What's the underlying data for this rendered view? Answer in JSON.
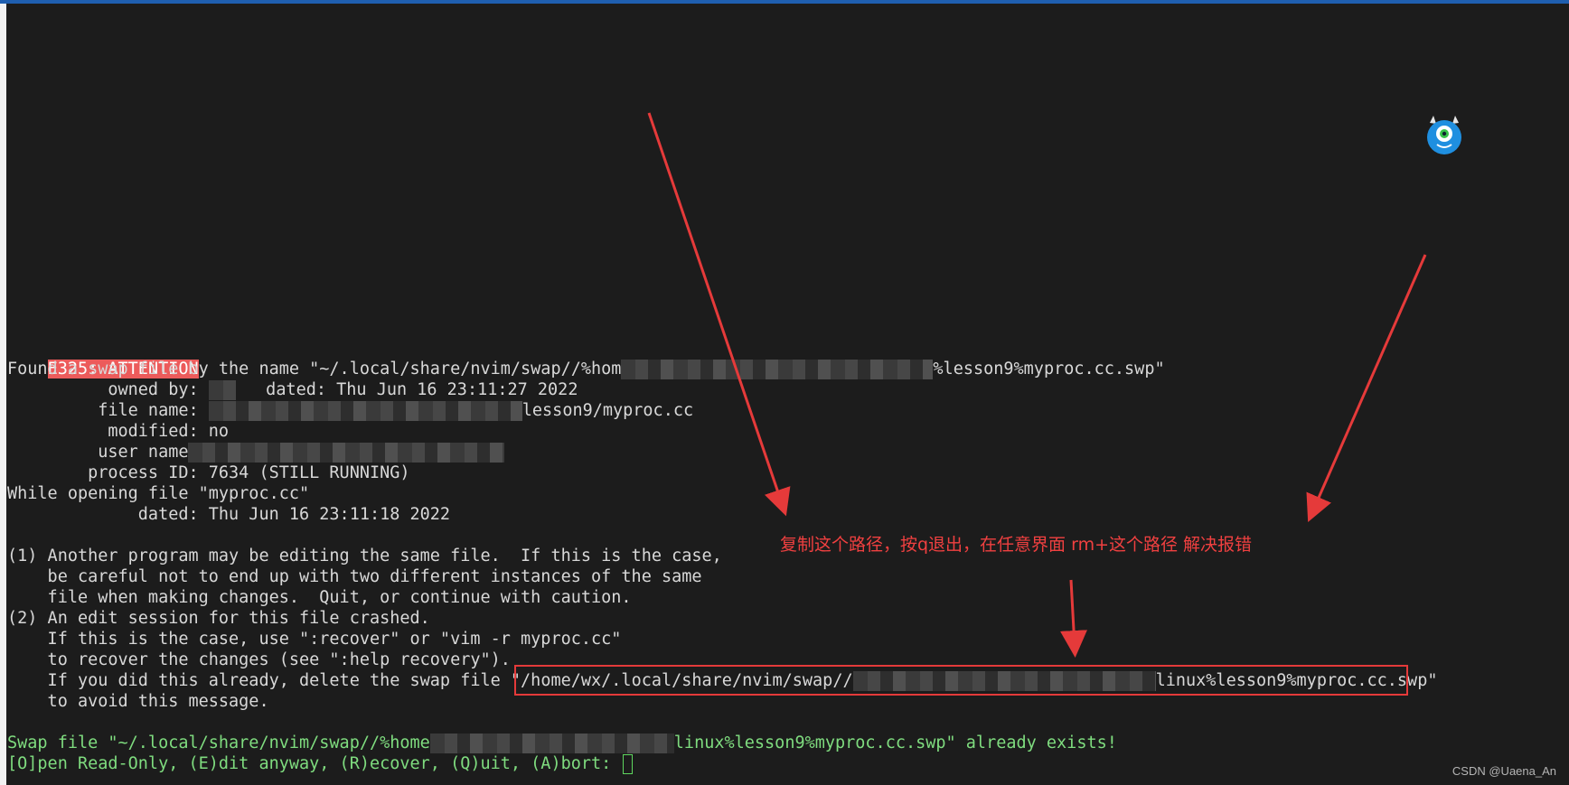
{
  "terminal": {
    "attention_label": "E325: ATTENTION",
    "found_prefix": "Found a swap file by the name \"~/.local/share/nvim/swap//%hom",
    "found_suffix": "%lesson9%myproc.cc.swp\"",
    "owned_by_label": "          owned by: ",
    "owned_by_dated": "   dated: Thu Jun 16 23:11:27 2022",
    "file_name_label": "         file name: ",
    "file_name_suffix": "lesson9/myproc.cc",
    "modified_line": "          modified: no",
    "user_name_label": "         user name",
    "process_line": "        process ID: 7634 (STILL RUNNING)",
    "while_opening": "While opening file \"myproc.cc\"",
    "dated_line": "             dated: Thu Jun 16 23:11:18 2022",
    "msg1": "(1) Another program may be editing the same file.  If this is the case,",
    "msg2": "    be careful not to end up with two different instances of the same",
    "msg3": "    file when making changes.  Quit, or continue with caution.",
    "msg4": "(2) An edit session for this file crashed.",
    "msg5": "    If this is the case, use \":recover\" or \"vim -r myproc.cc\"",
    "msg6": "    to recover the changes (see \":help recovery\").",
    "msg7_prefix": "    If you did this already, delete the swap file \"",
    "msg7_path_start": "/home/wx/.local/share/nvim/swap//",
    "msg7_path_end": "linux%lesson9%myproc.cc.swp",
    "msg7_suffix": "\"",
    "msg8": "    to avoid this message.",
    "exists_prefix": "Swap file \"~/.local/share/nvim/swap//%home",
    "exists_suffix": "linux%lesson9%myproc.cc.swp\" already exists!",
    "prompt": "[O]pen Read-Only, (E)dit anyway, (R)ecover, (Q)uit, (A)bort: "
  },
  "annotation": {
    "note": "复制这个路径，按q退出，在任意界面 rm+这个路径 解决报错"
  },
  "watermark": "CSDN @Uaena_An",
  "colors": {
    "background": "#1c1c1c",
    "text": "#d8d8d8",
    "green_text": "#7fdc7f",
    "attention_bg": "#ec5b5b",
    "annotation_red": "#f04040",
    "title_bar_blue": "#1f5fb0"
  },
  "icons": {
    "mascot": "blue-monster-mascot-icon",
    "cursor": "block-cursor-icon"
  }
}
